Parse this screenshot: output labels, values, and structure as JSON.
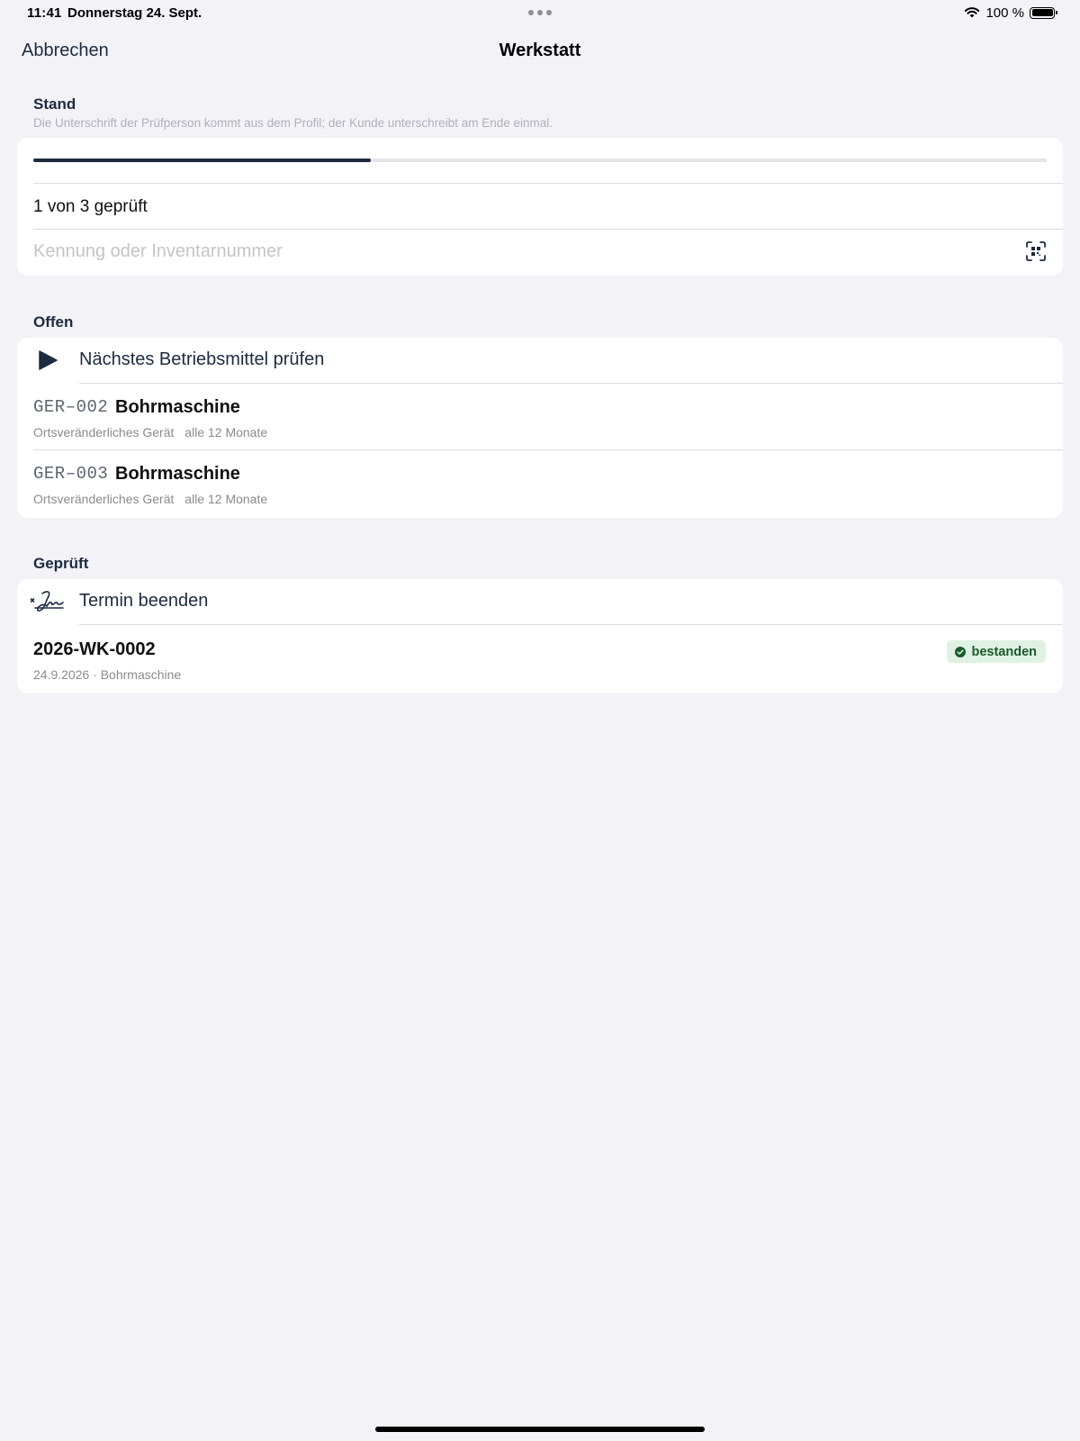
{
  "status_bar": {
    "time": "11:41",
    "date": "Donnerstag 24. Sept.",
    "battery": "100 %",
    "icons": [
      "wifi-icon",
      "battery-icon",
      "multitasking-dots-icon"
    ]
  },
  "nav": {
    "cancel_label": "Abbrechen",
    "title": "Werkstatt"
  },
  "progress_section": {
    "title": "Stand",
    "subtitle": "Die Unterschrift der Prüfperson kommt aus dem Profil; der Kunde unterschreibt am Ende einmal.",
    "checked": 1,
    "total": 3,
    "progress_fraction": 0.333,
    "progress_text": "1 von 3 geprüft",
    "search_placeholder": "Kennung oder Inventarnummer",
    "search_value": "",
    "scan_icon": "qr-scan-icon"
  },
  "open_section": {
    "title": "Offen",
    "action": {
      "label": "Nächstes Betriebsmittel prüfen",
      "icon": "play-icon"
    },
    "items": [
      {
        "code": "GER–002",
        "name": "Bohrmaschine",
        "type": "Ortsveränderliches Gerät",
        "interval": "alle 12 Monate"
      },
      {
        "code": "GER–003",
        "name": "Bohrmaschine",
        "type": "Ortsveränderliches Gerät",
        "interval": "alle 12 Monate"
      }
    ]
  },
  "checked_section": {
    "title": "Geprüft",
    "action": {
      "label": "Termin beenden",
      "icon": "signature-icon"
    },
    "items": [
      {
        "id": "2026-WK-0002",
        "meta": "24.9.2026 · Bohrmaschine",
        "status": "bestanden",
        "status_color": "#1d5a2b",
        "status_bg": "#dff1e2"
      }
    ]
  },
  "colors": {
    "accent": "#1c2b3f",
    "background": "#f2f2f7",
    "success": "#1d5a2b"
  }
}
